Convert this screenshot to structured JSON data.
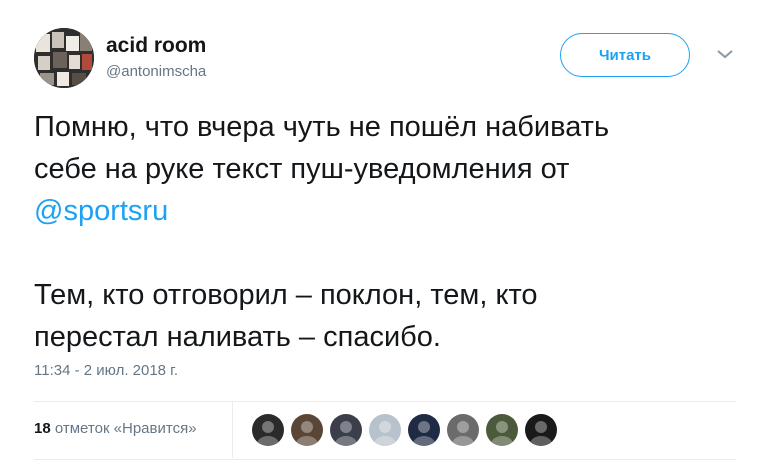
{
  "author": {
    "display_name": "acid room",
    "handle": "@antonimscha",
    "avatar_icon": "user-avatar-collage"
  },
  "follow_button": {
    "label": "Читать"
  },
  "more_menu_icon": "chevron-down-icon",
  "tweet": {
    "line1": "Помню, что вчера чуть не пошёл набивать",
    "line2": "себе на руке текст пуш-уведомления от",
    "mention": "@sportsru",
    "line4": "Тем, кто отговорил – поклон, тем, кто",
    "line5": "перестал наливать – спасибо."
  },
  "timestamp": "11:34 - 2 июл. 2018 г.",
  "likes": {
    "count": "18",
    "label": " отметок «Нравится»"
  },
  "likers": [
    {
      "name": "liker-avatar-1",
      "color": "#2b2b2b"
    },
    {
      "name": "liker-avatar-2",
      "color": "#5a4636"
    },
    {
      "name": "liker-avatar-3",
      "color": "#3b3f4a"
    },
    {
      "name": "liker-avatar-4",
      "color": "#b8c2cc"
    },
    {
      "name": "liker-avatar-5",
      "color": "#1f2a44"
    },
    {
      "name": "liker-avatar-6",
      "color": "#6b6b6b"
    },
    {
      "name": "liker-avatar-7",
      "color": "#4a5a3a"
    },
    {
      "name": "liker-avatar-8",
      "color": "#1a1a1a"
    }
  ],
  "colors": {
    "accent": "#1da1f2",
    "secondary_text": "#657786",
    "divider": "#e6ecf0"
  }
}
